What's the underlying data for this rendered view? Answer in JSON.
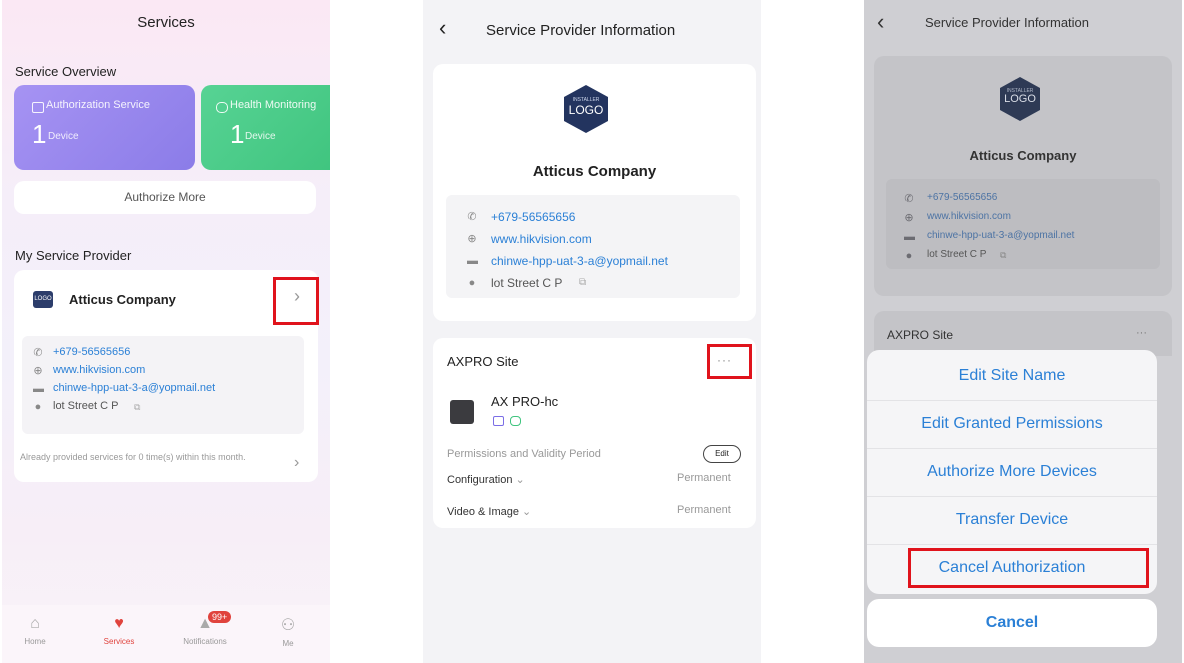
{
  "screen1": {
    "title": "Services",
    "overview_label": "Service Overview",
    "tiles": [
      {
        "label": "Authorization Service",
        "count": "1",
        "unit": "Device",
        "icon": "authorization-icon",
        "color": "#9f8af0"
      },
      {
        "label": "Health Monitoring",
        "count": "1",
        "unit": "Device",
        "icon": "health-icon",
        "color": "#4fd08e"
      }
    ],
    "authorize_more": "Authorize More",
    "provider_section_label": "My Service Provider",
    "provider": {
      "logo_text": "LOGO",
      "name": "Atticus Company",
      "phone": "+679-56565656",
      "website": "www.hikvision.com",
      "email": "chinwe-hpp-uat-3-a@yopmail.net",
      "address": "lot Street C P"
    },
    "usage_note": "Already provided services for 0 time(s) within this month.",
    "tabbar": {
      "items": [
        {
          "label": "Home",
          "icon": "home-icon"
        },
        {
          "label": "Services",
          "icon": "heart-icon"
        },
        {
          "label": "Notifications",
          "icon": "bell-icon",
          "badge": "99+"
        },
        {
          "label": "Me",
          "icon": "user-icon"
        }
      ],
      "active_color": "#e0433d"
    }
  },
  "screen2": {
    "title": "Service Provider Information",
    "provider": {
      "logo_caption": "INSTALLER",
      "logo_text": "LOGO",
      "name": "Atticus Company",
      "phone": "+679-56565656",
      "website": "www.hikvision.com",
      "email": "chinwe-hpp-uat-3-a@yopmail.net",
      "address": "lot Street C P"
    },
    "site": {
      "name": "AXPRO Site",
      "more": "···",
      "device_name": "AX PRO-hc",
      "permissions_label": "Permissions and Validity Period",
      "edit_label": "Edit",
      "rows": [
        {
          "label": "Configuration",
          "value": "Permanent"
        },
        {
          "label": "Video & Image",
          "value": "Permanent"
        }
      ]
    }
  },
  "screen3": {
    "title": "Service Provider Information",
    "provider": {
      "logo_caption": "INSTALLER",
      "logo_text": "LOGO",
      "name": "Atticus Company",
      "phone": "+679-56565656",
      "website": "www.hikvision.com",
      "email": "chinwe-hpp-uat-3-a@yopmail.net",
      "address": "lot Street C P"
    },
    "site_name": "AXPRO Site",
    "more": "···",
    "action_sheet": [
      "Edit Site Name",
      "Edit Granted Permissions",
      "Authorize More Devices",
      "Transfer Device",
      "Cancel Authorization"
    ],
    "cancel_label": "Cancel"
  },
  "highlight_color": "#e0131c",
  "link_color": "#2b80d6"
}
